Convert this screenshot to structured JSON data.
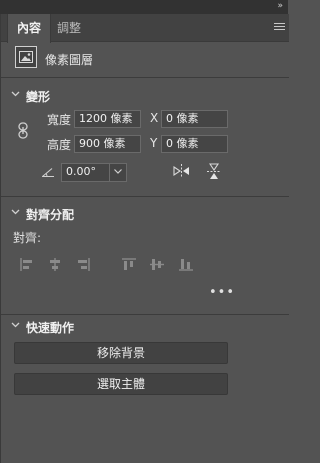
{
  "tabs": [
    {
      "label": "內容",
      "active": true
    },
    {
      "label": "調整",
      "active": false
    }
  ],
  "layer": {
    "label": "像素圖層"
  },
  "transform": {
    "title": "變形",
    "width_label": "寬度",
    "width_value": "1200 像素",
    "height_label": "高度",
    "height_value": "900 像素",
    "x_label": "X",
    "x_value": "0 像素",
    "y_label": "Y",
    "y_value": "0 像素",
    "angle_value": "0.00°"
  },
  "align": {
    "title": "對齊分配",
    "label": "對齊:",
    "more": "•••"
  },
  "quick_actions": {
    "title": "快速動作",
    "remove_background": "移除背景",
    "select_subject": "選取主體"
  },
  "colors": {
    "panel_bg": "#535353",
    "tab_bar_bg": "#424242",
    "field_bg": "#454545",
    "text": "#e6e6e6"
  }
}
